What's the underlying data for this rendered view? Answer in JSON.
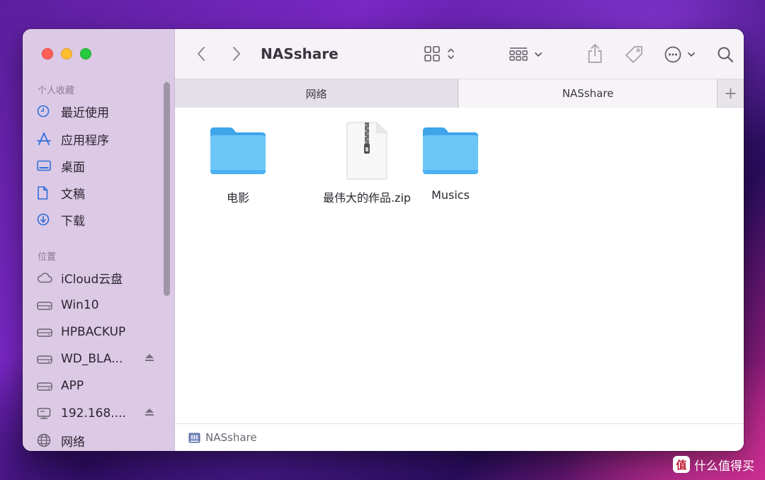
{
  "window": {
    "title": "NASshare"
  },
  "sidebar": {
    "sections": [
      {
        "title": "个人收藏",
        "items": [
          {
            "label": "最近使用",
            "icon": "clock-icon"
          },
          {
            "label": "应用程序",
            "icon": "applications-icon"
          },
          {
            "label": "桌面",
            "icon": "desktop-icon"
          },
          {
            "label": "文稿",
            "icon": "document-icon"
          },
          {
            "label": "下载",
            "icon": "download-icon"
          }
        ]
      },
      {
        "title": "位置",
        "items": [
          {
            "label": "iCloud云盘",
            "icon": "cloud-icon"
          },
          {
            "label": "Win10",
            "icon": "drive-icon"
          },
          {
            "label": "HPBACKUP",
            "icon": "drive-icon"
          },
          {
            "label": "WD_BLA...",
            "icon": "drive-icon",
            "eject": true
          },
          {
            "label": "APP",
            "icon": "drive-icon"
          },
          {
            "label": "192.168....",
            "icon": "server-icon",
            "eject": true
          },
          {
            "label": "网络",
            "icon": "network-icon"
          }
        ]
      }
    ]
  },
  "tabs": [
    {
      "label": "网络",
      "active": false
    },
    {
      "label": "NASshare",
      "active": true
    }
  ],
  "tab_add_label": "+",
  "files": [
    {
      "name": "电影",
      "kind": "folder",
      "icon": "folder-icon"
    },
    {
      "name": "最伟大的作品.zip",
      "kind": "zip",
      "icon": "zip-file-icon",
      "badge": "ZIP"
    },
    {
      "name": "Musics",
      "kind": "folder",
      "icon": "folder-icon"
    }
  ],
  "statusbar": {
    "path": "NASshare"
  },
  "watermark": {
    "badge": "值",
    "text": "什么值得买"
  },
  "colors": {
    "sidebar_bg": "#dcc9e6",
    "accent": "#2f6fd8",
    "folder": "#5fb8f3",
    "traffic_red": "#fe5f57",
    "traffic_yellow": "#febc2e",
    "traffic_green": "#28c840"
  }
}
